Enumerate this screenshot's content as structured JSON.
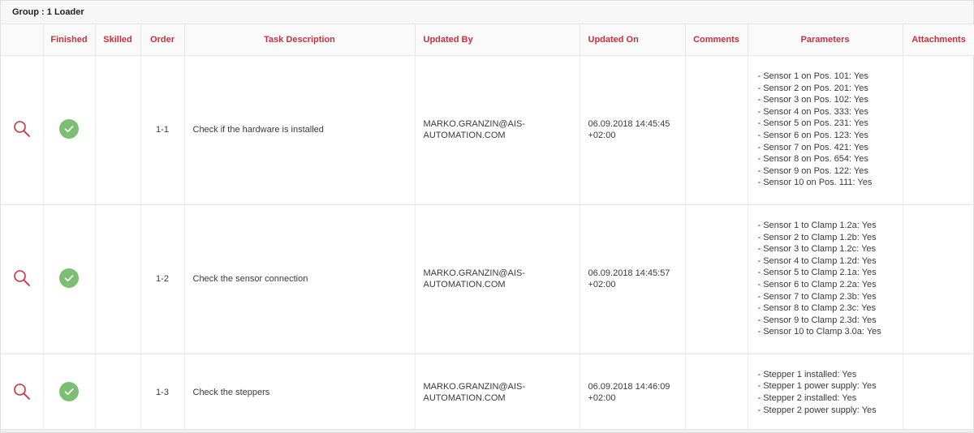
{
  "group": {
    "title": "Group : 1 Loader"
  },
  "table": {
    "columns": [
      "",
      "Finished",
      "Skilled",
      "Order",
      "Task Description",
      "Updated By",
      "Updated On",
      "Comments",
      "Parameters",
      "Attachments"
    ],
    "rows": [
      {
        "finished": true,
        "skilled": "",
        "order": "1-1",
        "task": "Check if the hardware is installed",
        "updated_by_line1": "MARKO.GRANZIN@AIS-",
        "updated_by_line2": "AUTOMATION.COM",
        "updated_on_line1": "06.09.2018 14:45:45",
        "updated_on_line2": "+02:00",
        "comments": "",
        "parameters": [
          "- Sensor 1 on Pos. 101: Yes",
          "- Sensor 2 on Pos. 201: Yes",
          "- Sensor 3 on Pos. 102: Yes",
          "- Sensor 4 on Pos. 333: Yes",
          "- Sensor 5 on Pos. 231: Yes",
          "- Sensor 6 on Pos. 123: Yes",
          "- Sensor 7 on Pos. 421: Yes",
          "- Sensor 8 on Pos. 654: Yes",
          "- Sensor 9 on Pos. 122: Yes",
          "- Sensor 10 on Pos. 111: Yes"
        ],
        "attachments": ""
      },
      {
        "finished": true,
        "skilled": "",
        "order": "1-2",
        "task": "Check the sensor connection",
        "updated_by_line1": "MARKO.GRANZIN@AIS-",
        "updated_by_line2": "AUTOMATION.COM",
        "updated_on_line1": "06.09.2018 14:45:57",
        "updated_on_line2": "+02:00",
        "comments": "",
        "parameters": [
          "- Sensor 1 to Clamp 1.2a: Yes",
          "- Sensor 2 to Clamp 1.2b: Yes",
          "- Sensor 3 to Clamp 1.2c: Yes",
          "- Sensor 4 to Clamp 1.2d: Yes",
          "- Sensor 5 to Clamp 2.1a: Yes",
          "- Sensor 6 to Clamp 2.2a: Yes",
          "- Sensor 7 to Clamp 2.3b: Yes",
          "- Sensor 8 to Clamp 2.3c: Yes",
          "- Sensor 9 to Clamp 2.3d: Yes",
          "- Sensor 10 to Clamp 3.0a: Yes"
        ],
        "attachments": ""
      },
      {
        "finished": true,
        "skilled": "",
        "order": "1-3",
        "task": "Check the steppers",
        "updated_by_line1": "MARKO.GRANZIN@AIS-",
        "updated_by_line2": "AUTOMATION.COM",
        "updated_on_line1": "06.09.2018 14:46:09",
        "updated_on_line2": "+02:00",
        "comments": "",
        "parameters": [
          "- Stepper 1  installed: Yes",
          "- Stepper 1 power supply: Yes",
          "- Stepper 2 installed: Yes",
          "- Stepper 2 power supply: Yes"
        ],
        "attachments": ""
      }
    ]
  },
  "icons": {
    "view": "search-icon",
    "finished": "check-circle-icon"
  },
  "colors": {
    "accent": "#c8313b",
    "success": "#7cbf73",
    "header_bg": "#fafafa"
  }
}
